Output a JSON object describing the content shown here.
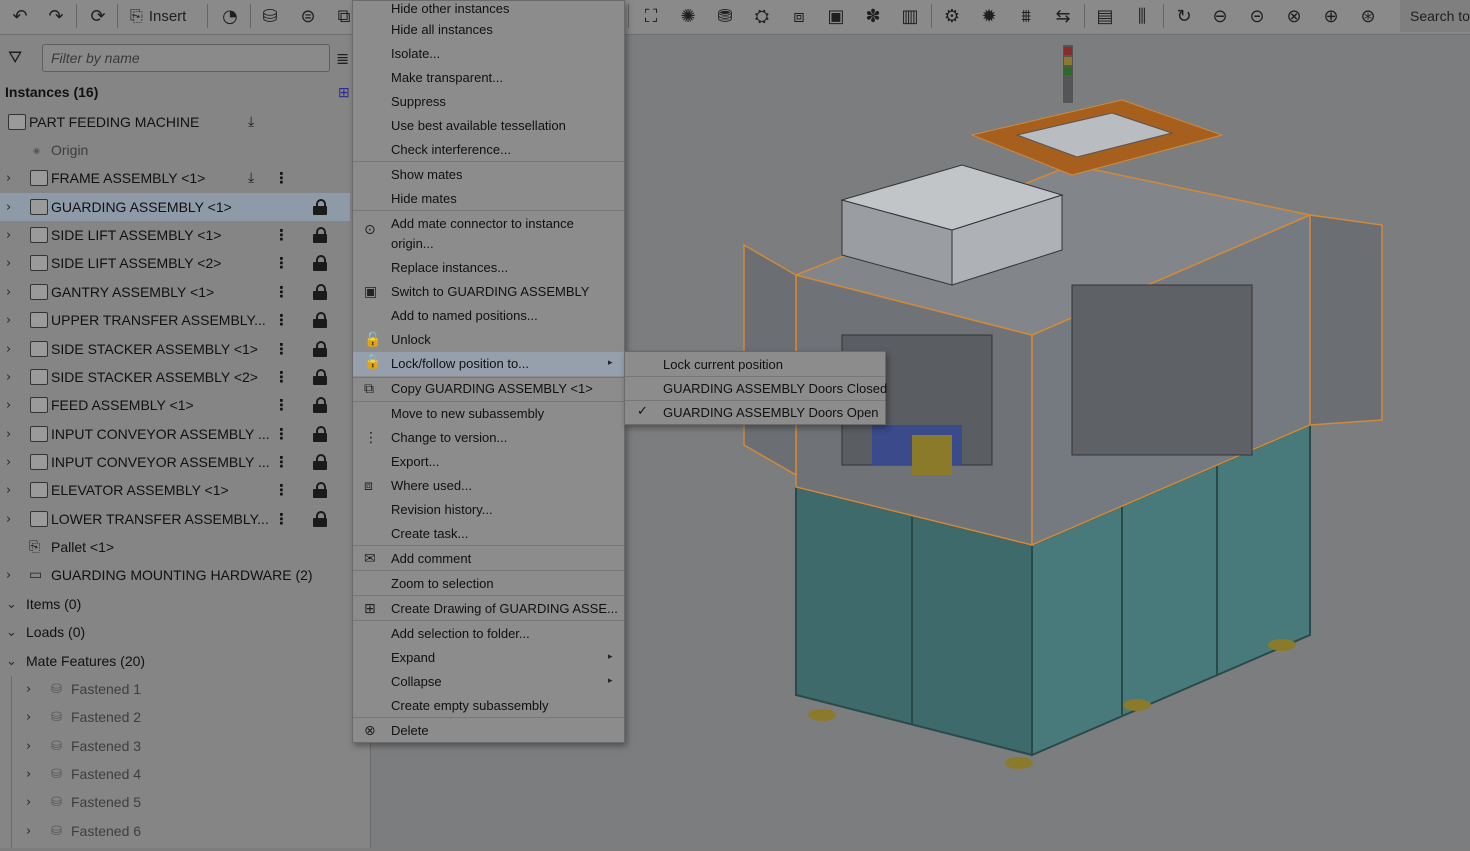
{
  "toolbar": {
    "insert_label": "Insert",
    "search_label": "Search to",
    "left_icons": [
      "undo-icon",
      "redo-icon",
      "sync-icon"
    ],
    "part_icons": [
      "history-icon",
      "cylinder-icon",
      "mate-icon",
      "replicate-icon"
    ],
    "view_icons": [
      "fit-icon",
      "explode-icon",
      "section-icon",
      "measure-icon",
      "mass-icon",
      "display-icon",
      "mate-connector-icon",
      "book-icon",
      "gear-icon",
      "gear2-icon",
      "rack-icon",
      "linear-icon",
      "bom-icon",
      "stack-icon",
      "revolute-icon",
      "cylindrical-icon",
      "planar-icon",
      "ball-icon",
      "fastened-icon",
      "tangent-icon"
    ]
  },
  "filter": {
    "placeholder": "Filter by name"
  },
  "instances": {
    "header": "Instances (16)",
    "root": "PART FEEDING MACHINE",
    "origin": "Origin",
    "items": [
      {
        "label": "FRAME ASSEMBLY <1>",
        "selected": false,
        "lock": false,
        "pin": true
      },
      {
        "label": "GUARDING ASSEMBLY <1>",
        "selected": true,
        "lock": true,
        "pin": false
      },
      {
        "label": "SIDE LIFT ASSEMBLY <1>",
        "selected": false,
        "lock": true,
        "pin": false
      },
      {
        "label": "SIDE LIFT ASSEMBLY <2>",
        "selected": false,
        "lock": true,
        "pin": false
      },
      {
        "label": "GANTRY ASSEMBLY <1>",
        "selected": false,
        "lock": true,
        "pin": false
      },
      {
        "label": "UPPER TRANSFER ASSEMBLY...",
        "selected": false,
        "lock": true,
        "pin": false
      },
      {
        "label": "SIDE STACKER ASSEMBLY <1>",
        "selected": false,
        "lock": true,
        "pin": false
      },
      {
        "label": "SIDE STACKER ASSEMBLY <2>",
        "selected": false,
        "lock": true,
        "pin": false
      },
      {
        "label": "FEED ASSEMBLY <1>",
        "selected": false,
        "lock": true,
        "pin": false
      },
      {
        "label": "INPUT CONVEYOR ASSEMBLY ...",
        "selected": false,
        "lock": true,
        "pin": false
      },
      {
        "label": "INPUT CONVEYOR ASSEMBLY ...",
        "selected": false,
        "lock": true,
        "pin": false
      },
      {
        "label": "ELEVATOR ASSEMBLY <1>",
        "selected": false,
        "lock": true,
        "pin": false
      },
      {
        "label": "LOWER TRANSFER ASSEMBLY...",
        "selected": false,
        "lock": true,
        "pin": false
      }
    ],
    "pallet": "Pallet <1>",
    "hardware": "GUARDING MOUNTING HARDWARE (2)"
  },
  "groups": {
    "items": "Items (0)",
    "loads": "Loads (0)",
    "mates": "Mate Features (20)"
  },
  "mates": [
    "Fastened 1",
    "Fastened 2",
    "Fastened 3",
    "Fastened 4",
    "Fastened 5",
    "Fastened 6"
  ],
  "context_menu": {
    "items": [
      {
        "label": "Hide other instances",
        "icon": ""
      },
      {
        "label": "Hide all instances",
        "icon": ""
      },
      {
        "label": "Isolate...",
        "icon": ""
      },
      {
        "label": "Make transparent...",
        "icon": ""
      },
      {
        "label": "Suppress",
        "icon": ""
      },
      {
        "label": "Use best available tessellation",
        "icon": ""
      },
      {
        "label": "Check interference...",
        "icon": ""
      },
      {
        "label": "Show mates",
        "icon": ""
      },
      {
        "label": "Hide mates",
        "icon": ""
      },
      {
        "label": "Add mate connector to instance",
        "label2": "origin...",
        "icon": "mate-connector-icon"
      },
      {
        "label": "Replace instances...",
        "icon": ""
      },
      {
        "label": "Switch to GUARDING ASSEMBLY",
        "icon": "assembly-icon"
      },
      {
        "label": "Add to named positions...",
        "icon": ""
      },
      {
        "label": "Unlock",
        "icon": "unlock-icon"
      },
      {
        "label": "Lock/follow position to...",
        "icon": "lock-icon",
        "submenu": true
      },
      {
        "label": "Copy GUARDING ASSEMBLY <1>",
        "icon": "copy-icon"
      },
      {
        "label": "Move to new subassembly",
        "icon": ""
      },
      {
        "label": "Change to version...",
        "icon": "version-icon"
      },
      {
        "label": "Export...",
        "icon": ""
      },
      {
        "label": "Where used...",
        "icon": "where-used-icon"
      },
      {
        "label": "Revision history...",
        "icon": ""
      },
      {
        "label": "Create task...",
        "icon": ""
      },
      {
        "label": "Add comment",
        "icon": "comment-icon"
      },
      {
        "label": "Zoom to selection",
        "icon": ""
      },
      {
        "label": "Create Drawing of GUARDING ASSE...",
        "icon": "drawing-icon"
      },
      {
        "label": "Add selection to folder...",
        "icon": ""
      },
      {
        "label": "Expand",
        "icon": "",
        "submenu": true
      },
      {
        "label": "Collapse",
        "icon": "",
        "submenu": true
      },
      {
        "label": "Create empty subassembly",
        "icon": ""
      },
      {
        "label": "Delete",
        "icon": "delete-icon"
      }
    ]
  },
  "submenu": {
    "items": [
      {
        "label": "Lock current position",
        "checked": false
      },
      {
        "label": "GUARDING ASSEMBLY Doors Closed",
        "checked": false
      },
      {
        "label": "GUARDING ASSEMBLY Doors Open",
        "checked": true
      }
    ]
  },
  "colors": {
    "panel": "#858585",
    "selection": "#8f9aa8",
    "frame_teal": "#3f6f70",
    "orange_top": "#a65f1c"
  }
}
